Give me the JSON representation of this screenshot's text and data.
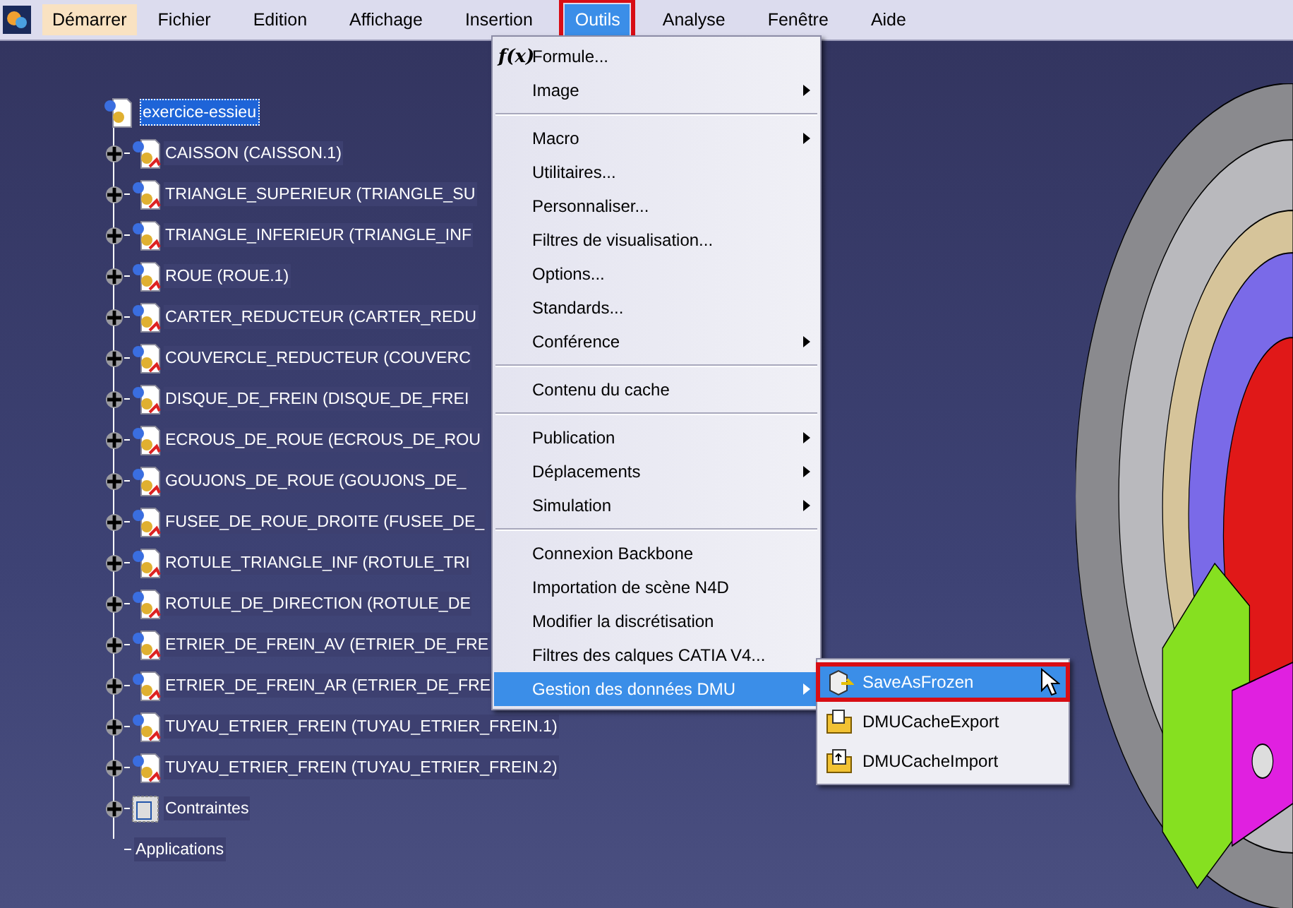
{
  "menubar": [
    {
      "label": "Démarrer",
      "kind": "start",
      "selected": false,
      "highlighted": false
    },
    {
      "label": "Fichier",
      "kind": "menu",
      "selected": false,
      "highlighted": false
    },
    {
      "label": "Edition",
      "kind": "menu",
      "selected": false,
      "highlighted": false
    },
    {
      "label": "Affichage",
      "kind": "menu",
      "selected": false,
      "highlighted": false
    },
    {
      "label": "Insertion",
      "kind": "menu",
      "selected": false,
      "highlighted": false
    },
    {
      "label": "Outils",
      "kind": "menu",
      "selected": true,
      "highlighted": true
    },
    {
      "label": "Analyse",
      "kind": "menu",
      "selected": false,
      "highlighted": false
    },
    {
      "label": "Fenêtre",
      "kind": "menu",
      "selected": false,
      "highlighted": false
    },
    {
      "label": "Aide",
      "kind": "menu",
      "selected": false,
      "highlighted": false
    }
  ],
  "tree": {
    "label": "exercice-essieu",
    "selected": true,
    "children": [
      {
        "label": "CAISSON (CAISSON.1)",
        "kind": "product",
        "expandable": true
      },
      {
        "label": "TRIANGLE_SUPERIEUR (TRIANGLE_SU",
        "kind": "product",
        "expandable": true
      },
      {
        "label": "TRIANGLE_INFERIEUR (TRIANGLE_INF",
        "kind": "product",
        "expandable": true
      },
      {
        "label": "ROUE (ROUE.1)",
        "kind": "product",
        "expandable": true
      },
      {
        "label": "CARTER_REDUCTEUR (CARTER_REDU",
        "kind": "product",
        "expandable": true
      },
      {
        "label": "COUVERCLE_REDUCTEUR (COUVERC",
        "kind": "product",
        "expandable": true
      },
      {
        "label": "DISQUE_DE_FREIN (DISQUE_DE_FREI",
        "kind": "product",
        "expandable": true
      },
      {
        "label": "ECROUS_DE_ROUE (ECROUS_DE_ROU",
        "kind": "product",
        "expandable": true
      },
      {
        "label": "GOUJONS_DE_ROUE (GOUJONS_DE_",
        "kind": "product",
        "expandable": true
      },
      {
        "label": "FUSEE_DE_ROUE_DROITE (FUSEE_DE_",
        "kind": "product",
        "expandable": true
      },
      {
        "label": "ROTULE_TRIANGLE_INF (ROTULE_TRI",
        "kind": "product",
        "expandable": true
      },
      {
        "label": "ROTULE_DE_DIRECTION (ROTULE_DE",
        "kind": "product",
        "expandable": true
      },
      {
        "label": "ETRIER_DE_FREIN_AV (ETRIER_DE_FRE",
        "kind": "product",
        "expandable": true
      },
      {
        "label": "ETRIER_DE_FREIN_AR (ETRIER_DE_FRE",
        "kind": "product",
        "expandable": true
      },
      {
        "label": "TUYAU_ETRIER_FREIN (TUYAU_ETRIER_FREIN.1)",
        "kind": "product",
        "expandable": true
      },
      {
        "label": "TUYAU_ETRIER_FREIN (TUYAU_ETRIER_FREIN.2)",
        "kind": "product",
        "expandable": true
      },
      {
        "label": "Contraintes",
        "kind": "constraints",
        "expandable": true
      },
      {
        "label": "Applications",
        "kind": "plain",
        "expandable": false
      }
    ]
  },
  "menu": [
    {
      "kind": "item",
      "label": "Formule...",
      "icon_text": "f(x)",
      "submenu": false,
      "selected": false
    },
    {
      "kind": "item",
      "label": "Image",
      "submenu": true,
      "selected": false
    },
    {
      "kind": "separator"
    },
    {
      "kind": "item",
      "label": "Macro",
      "submenu": true,
      "selected": false
    },
    {
      "kind": "item",
      "label": "Utilitaires...",
      "submenu": false,
      "selected": false
    },
    {
      "kind": "item",
      "label": "Personnaliser...",
      "submenu": false,
      "selected": false
    },
    {
      "kind": "item",
      "label": "Filtres de visualisation...",
      "submenu": false,
      "selected": false
    },
    {
      "kind": "item",
      "label": "Options...",
      "submenu": false,
      "selected": false
    },
    {
      "kind": "item",
      "label": "Standards...",
      "submenu": false,
      "selected": false
    },
    {
      "kind": "item",
      "label": "Conférence",
      "submenu": true,
      "selected": false
    },
    {
      "kind": "separator"
    },
    {
      "kind": "item",
      "label": "Contenu du cache",
      "submenu": false,
      "selected": false
    },
    {
      "kind": "separator"
    },
    {
      "kind": "item",
      "label": "Publication",
      "submenu": true,
      "selected": false
    },
    {
      "kind": "item",
      "label": "Déplacements",
      "submenu": true,
      "selected": false
    },
    {
      "kind": "item",
      "label": "Simulation",
      "submenu": true,
      "selected": false
    },
    {
      "kind": "separator"
    },
    {
      "kind": "item",
      "label": "Connexion Backbone",
      "submenu": false,
      "selected": false
    },
    {
      "kind": "item",
      "label": "Importation de scène N4D",
      "submenu": false,
      "selected": false
    },
    {
      "kind": "item",
      "label": "Modifier la discrétisation",
      "submenu": false,
      "selected": false
    },
    {
      "kind": "item",
      "label": "Filtres des calques CATIA V4...",
      "submenu": false,
      "selected": false
    },
    {
      "kind": "item",
      "label": "Gestion des données DMU",
      "submenu": true,
      "selected": true
    }
  ],
  "submenu": [
    {
      "label": "SaveAsFrozen",
      "kind": "frozen",
      "selected": true,
      "highlighted": true
    },
    {
      "label": "DMUCacheExport",
      "kind": "export",
      "selected": false,
      "highlighted": false
    },
    {
      "label": "DMUCacheImport",
      "kind": "import",
      "selected": false,
      "highlighted": false
    }
  ]
}
